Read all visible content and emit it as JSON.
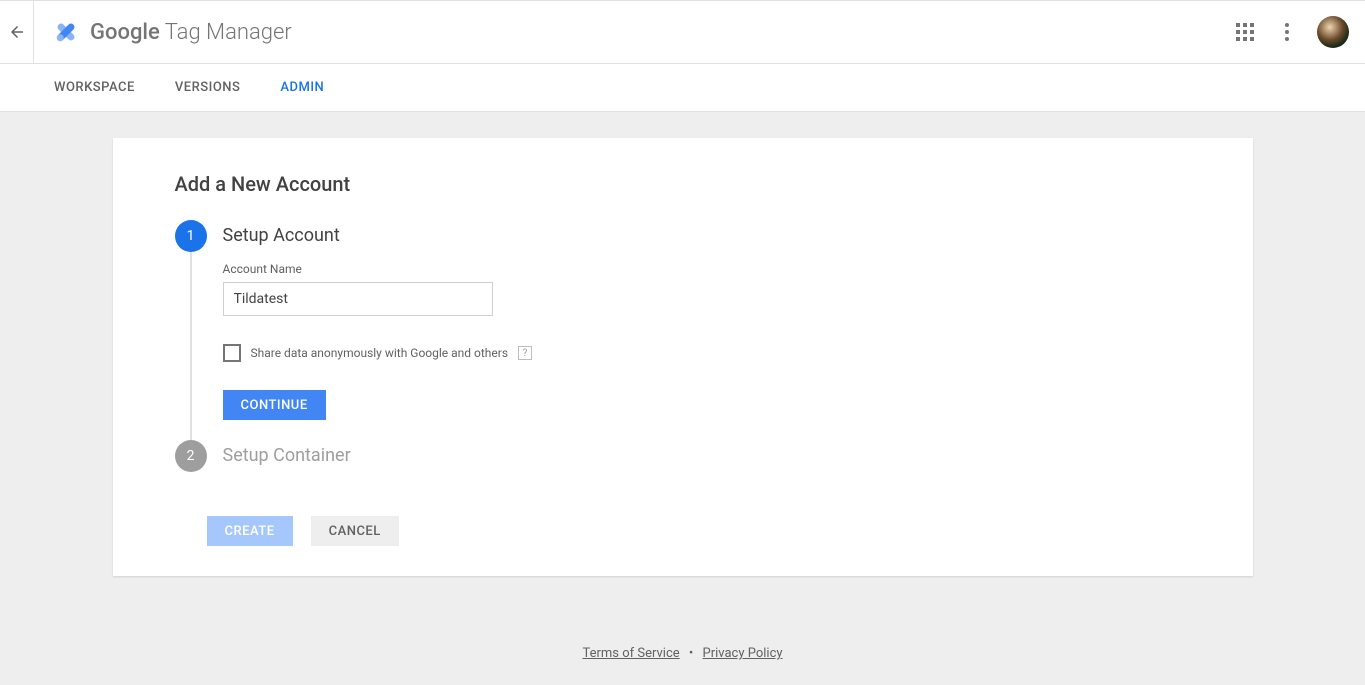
{
  "brand": {
    "bold": "Google",
    "light": " Tag Manager"
  },
  "tabs": {
    "workspace": "WORKSPACE",
    "versions": "VERSIONS",
    "admin": "ADMIN"
  },
  "card": {
    "title": "Add a New Account",
    "step1": {
      "num": "1",
      "label": "Setup Account"
    },
    "step2": {
      "num": "2",
      "label": "Setup Container"
    },
    "account_name_label": "Account Name",
    "account_name_value": "Tildatest",
    "share_label": "Share data anonymously with Google and others",
    "help_char": "?",
    "continue": "CONTINUE",
    "create": "CREATE",
    "cancel": "CANCEL"
  },
  "legal": {
    "tos": "Terms of Service",
    "dot": "•",
    "privacy": "Privacy Policy"
  }
}
